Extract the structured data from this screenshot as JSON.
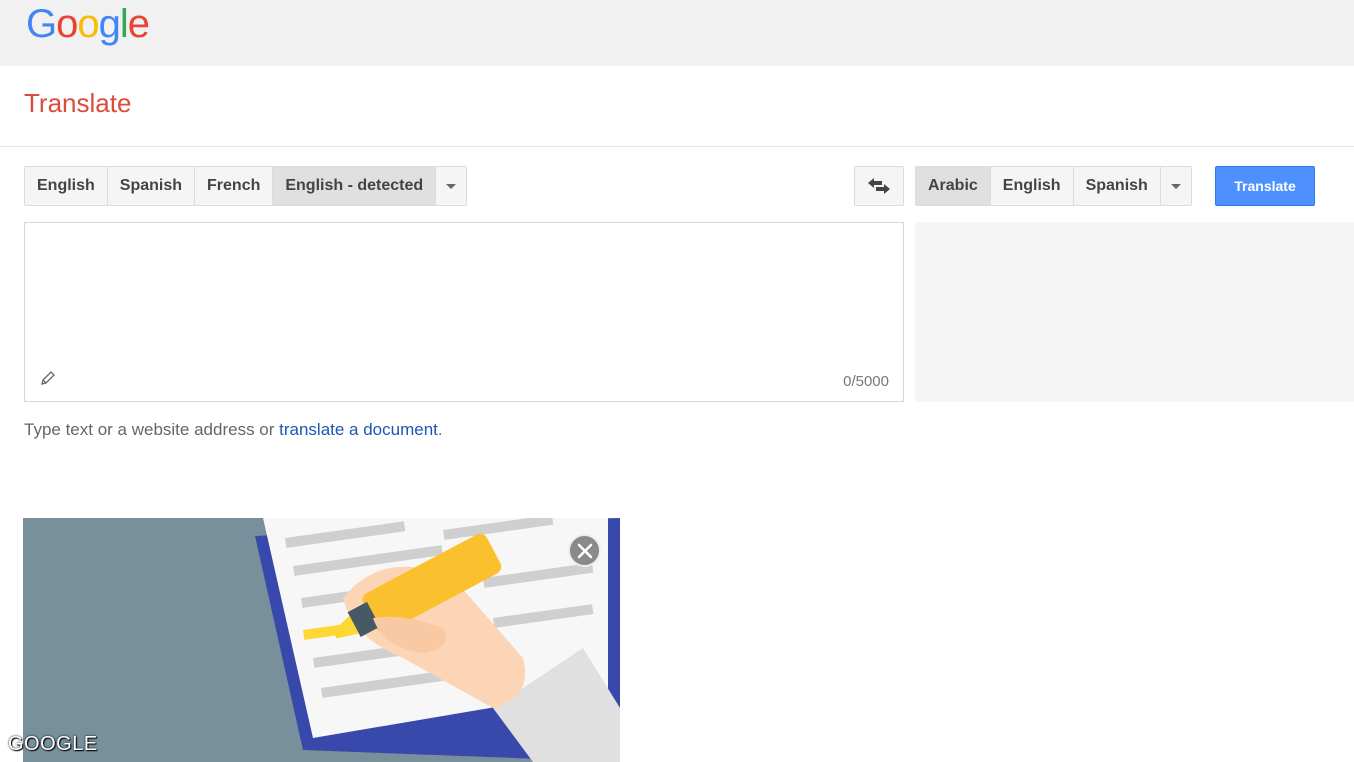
{
  "header": {
    "logo_letters": [
      "G",
      "o",
      "o",
      "g",
      "l",
      "e"
    ],
    "logo_colors": [
      "#4285f4",
      "#ea4335",
      "#fbbc05",
      "#4285f4",
      "#34a853",
      "#ea4335"
    ],
    "title": "Translate"
  },
  "source_langs": {
    "items": [
      {
        "label": "English",
        "active": false
      },
      {
        "label": "Spanish",
        "active": false
      },
      {
        "label": "French",
        "active": false
      },
      {
        "label": "English - detected",
        "active": true
      }
    ]
  },
  "target_langs": {
    "items": [
      {
        "label": "Arabic",
        "active": true
      },
      {
        "label": "English",
        "active": false
      },
      {
        "label": "Spanish",
        "active": false
      }
    ]
  },
  "swap_icon": "swap-arrows-icon",
  "translate_button": "Translate",
  "source_box": {
    "text": "",
    "counter": "0/5000",
    "icon": "pencil-icon"
  },
  "hint": {
    "prefix": "Type text or a website address or ",
    "link": "translate a document",
    "suffix": "."
  },
  "promo": {
    "illustration": "hand-highlighting-document",
    "close_icon": "close-icon"
  },
  "watermark": "GOOGLE",
  "colors": {
    "accent": "#4d90fe",
    "title_red": "#dd4b39",
    "link_blue": "#1a57b5"
  }
}
